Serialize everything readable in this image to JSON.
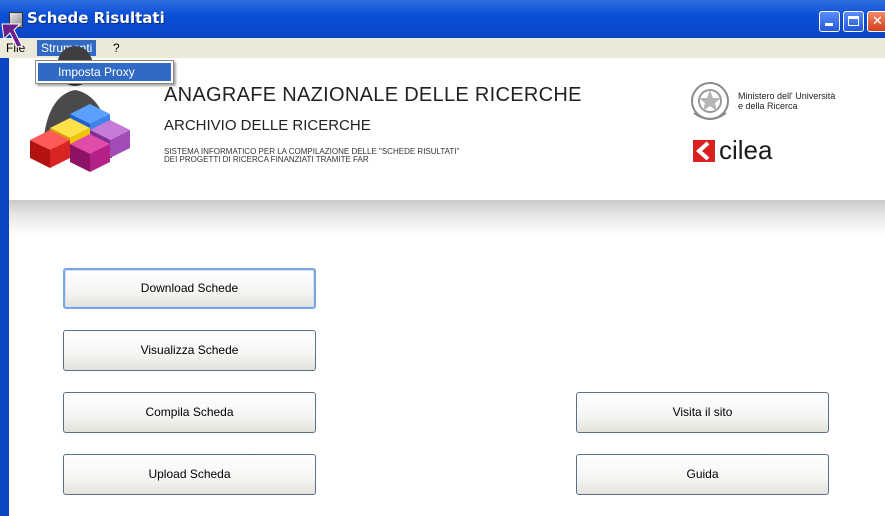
{
  "window": {
    "title": "Schede Risultati"
  },
  "menubar": {
    "file": "File",
    "strumenti": "Strumenti",
    "help": "?"
  },
  "dropdown": {
    "items": [
      "Imposta Proxy"
    ]
  },
  "header": {
    "title": "ANAGRAFE NAZIONALE DELLE RICERCHE",
    "subtitle": "ARCHIVIO DELLE RICERCHE",
    "desc_line1": "SISTEMA INFORMATICO PER LA COMPILAZIONE DELLE \"SCHEDE RISULTATI\"",
    "desc_line2": "DEI PROGETTI DI RICERCA FINANZIATI TRAMITE FAR",
    "ministry_line1": "Ministero dell' Università",
    "ministry_line2": "e della Ricerca",
    "partner": "cilea"
  },
  "buttons": {
    "download": "Download Schede",
    "visualizza": "Visualizza Schede",
    "compila": "Compila Scheda",
    "upload": "Upload Scheda",
    "visita": "Visita il sito",
    "guida": "Guida"
  },
  "colors": {
    "titlebar": "#0a46c4",
    "menu_highlight": "#316ac5",
    "cilea_red": "#d9201f"
  }
}
